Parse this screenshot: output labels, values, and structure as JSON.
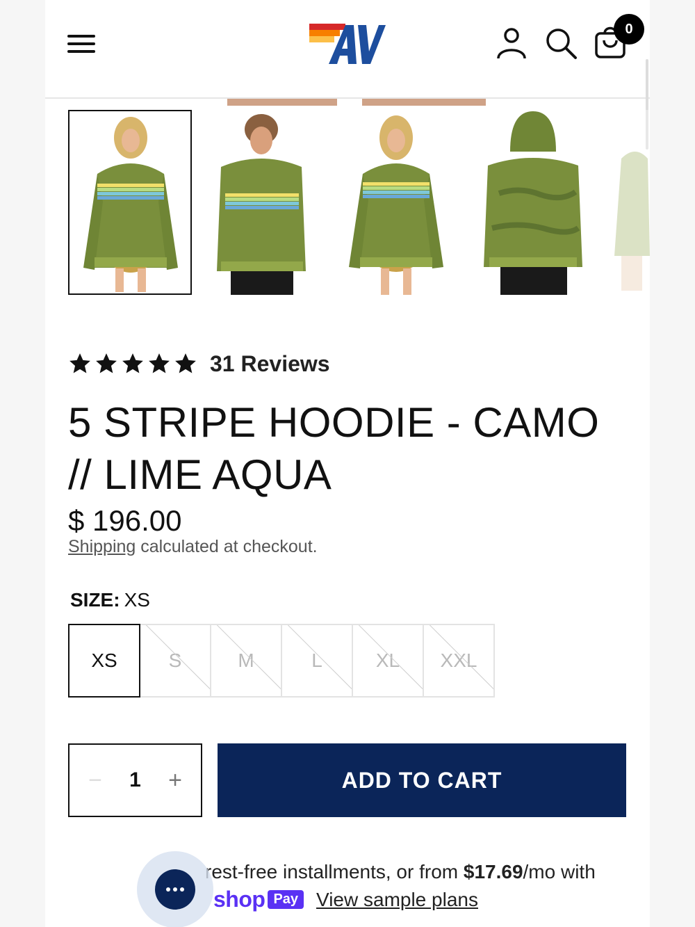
{
  "header": {
    "menu_icon": "hamburger-menu-icon",
    "logo": "brand-logo",
    "cart_count": "0"
  },
  "product": {
    "rating": 5,
    "reviews_text": "31 Reviews",
    "title_line1": "5 STRIPE HOODIE - CAMO",
    "title_line2": "// LIME AQUA",
    "price": "$ 196.00",
    "shipping_link": "Shipping",
    "shipping_rest": " calculated at checkout."
  },
  "size": {
    "label": "SIZE:",
    "selected": "XS",
    "options": [
      "XS",
      "S",
      "M",
      "L",
      "XL",
      "XXL"
    ]
  },
  "purchase": {
    "quantity": "1",
    "minus": "−",
    "plus": "+",
    "add_to_cart": "ADD TO CART"
  },
  "installments": {
    "text_before": "rest-free installments, or from ",
    "amount": "$17.69",
    "text_after": "/mo with",
    "shop_word": "shop",
    "pay_badge": "Pay",
    "view_plans": "View sample plans"
  },
  "colors": {
    "button_navy": "#0b2559",
    "shop_purple": "#5a31f4",
    "camo_green": "#7a8f3c"
  }
}
